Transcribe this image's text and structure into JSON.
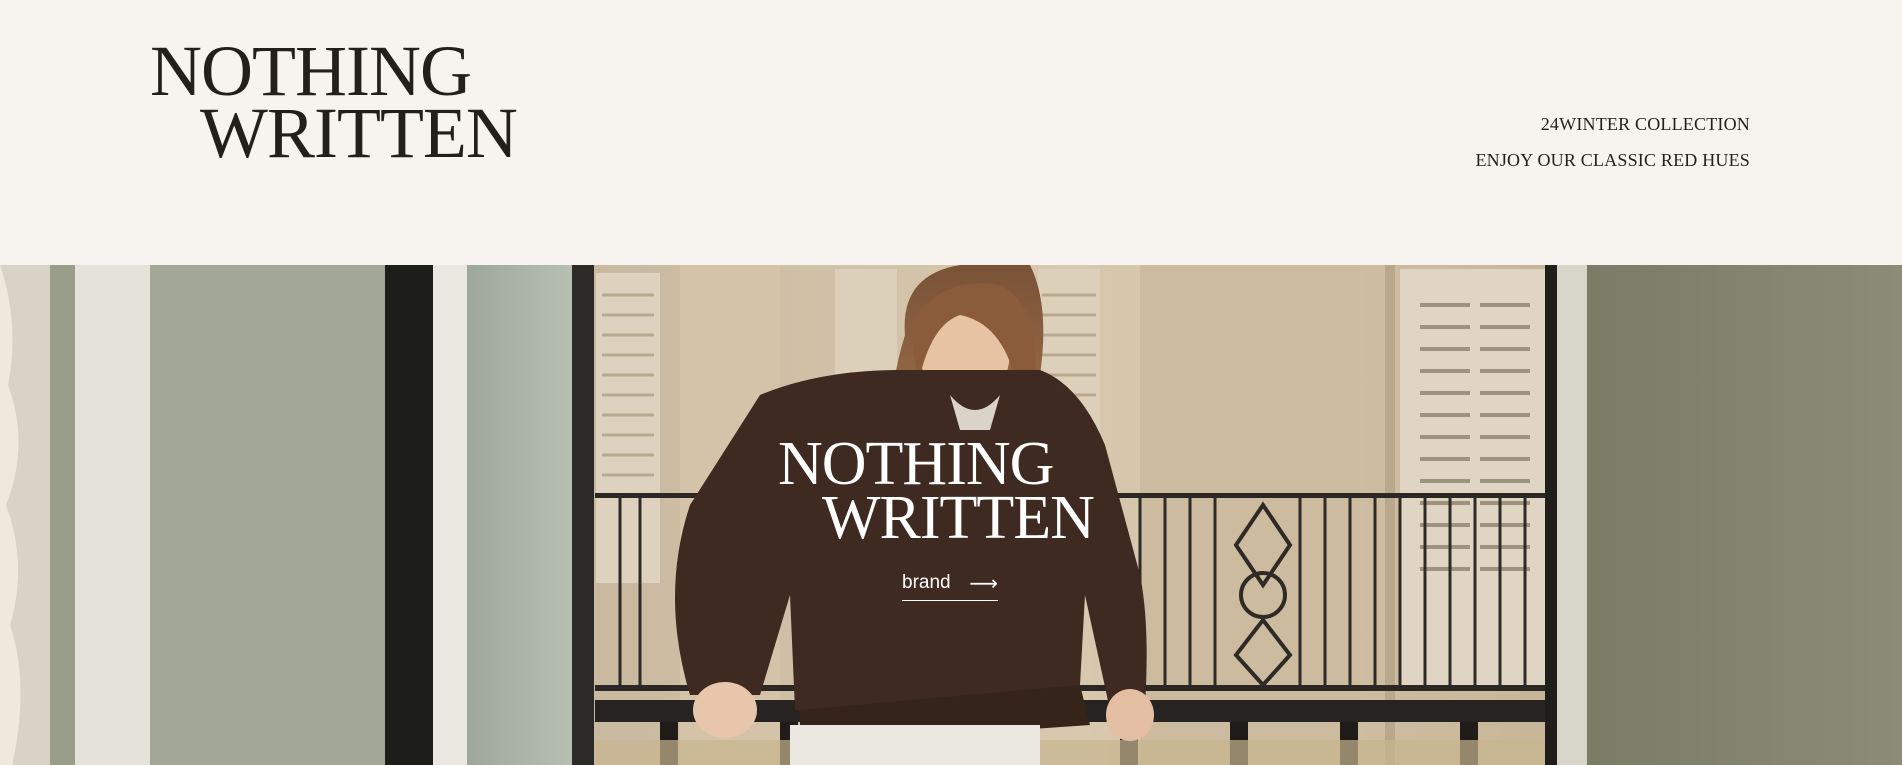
{
  "header": {
    "logo": {
      "line1": "NOTHING",
      "line2": "WRITTEN"
    },
    "collection_line": "24WINTER COLLECTION",
    "tagline": "ENJOY OUR CLASSIC RED HUES"
  },
  "hero": {
    "logo": {
      "line1": "NOTHING",
      "line2": "WRITTEN"
    },
    "brand_link": {
      "label": "brand",
      "icon": "arrow-right-icon"
    }
  },
  "colors": {
    "background": "#f7f3ee",
    "text": "#231f1c",
    "hero_text": "#ffffff",
    "sweater": "#3e2a20"
  }
}
